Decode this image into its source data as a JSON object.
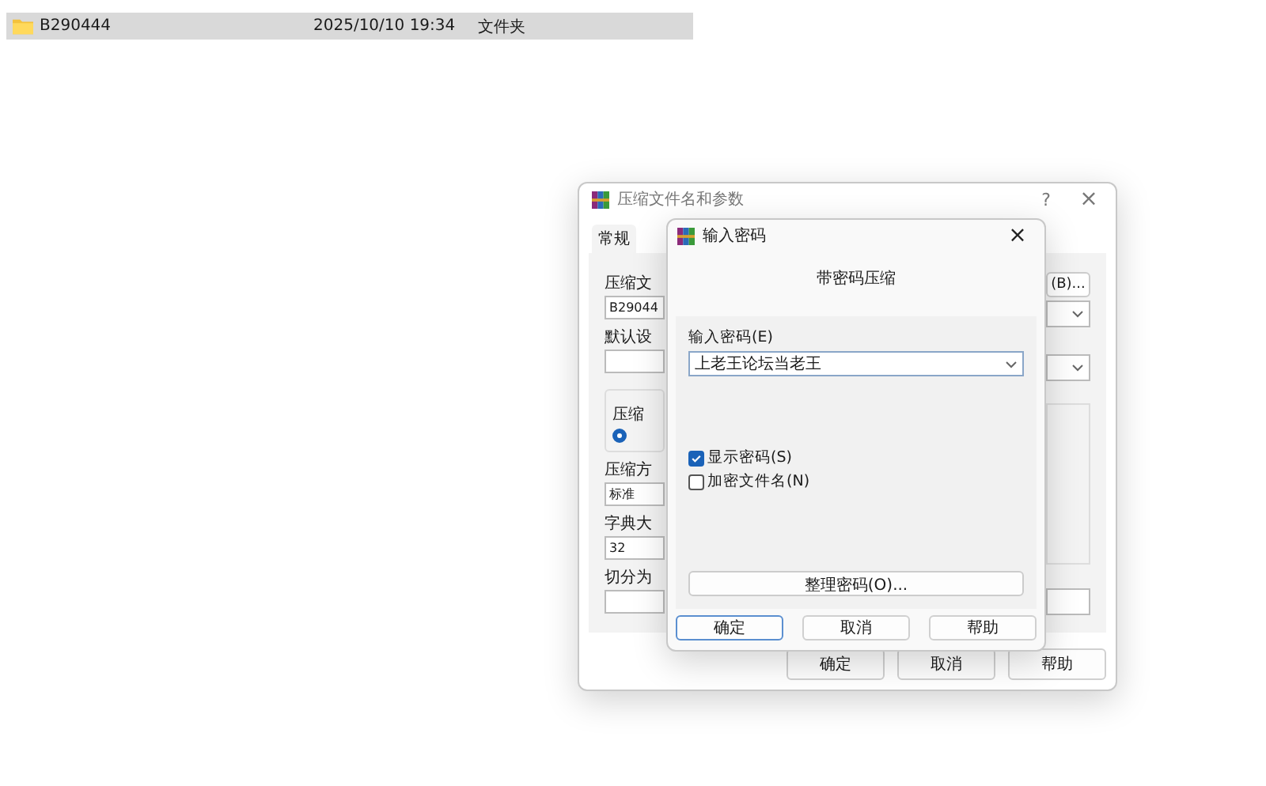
{
  "file_row": {
    "name": "B290444",
    "modified": "2025/10/10 19:34",
    "type": "文件夹",
    "selected": true
  },
  "back_window": {
    "title": "压缩文件名和参数",
    "help": "?",
    "close": "×",
    "tab": {
      "label": "常规",
      "selected": true
    },
    "fields": [
      {
        "label": "压缩文",
        "value": "B29044"
      },
      {
        "label": "默认设"
      },
      {
        "kind": "group",
        "label": "压缩",
        "option_selected": true
      },
      {
        "label": "压缩方",
        "value": "标准"
      },
      {
        "label": "字典大",
        "value": "32"
      },
      {
        "label": "切分为"
      }
    ],
    "browse_button": "(B)...",
    "buttons": [
      "确定",
      "取消",
      "帮助"
    ]
  },
  "dialog": {
    "title": "输入密码",
    "close": "×",
    "heading": "带密码压缩",
    "password_label": "输入密码(E)",
    "password_value": "上老王论坛当老王",
    "options": [
      {
        "label": "显示密码(S)",
        "checked": true
      },
      {
        "label": "加密文件名(N)",
        "checked": false
      }
    ],
    "organize_button": "整理密码(O)...",
    "buttons": [
      {
        "label": "确定",
        "default": true
      },
      {
        "label": "取消",
        "default": false
      },
      {
        "label": "帮助",
        "default": false
      }
    ]
  }
}
